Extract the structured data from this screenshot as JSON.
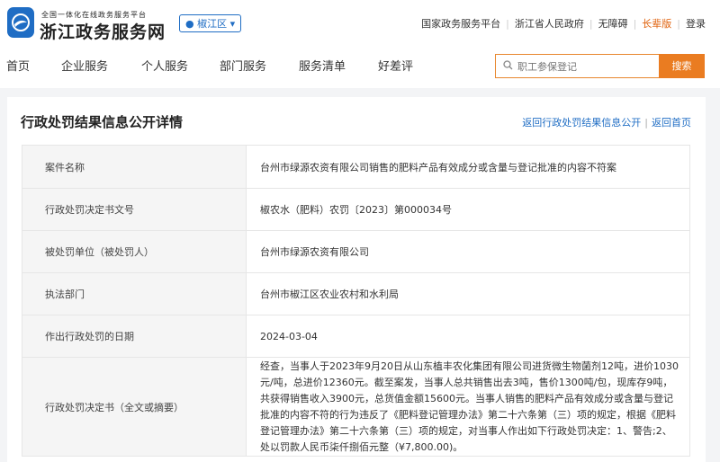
{
  "brand": {
    "subtitle": "全国一体化在线政务服务平台",
    "title": "浙江政务服务网"
  },
  "region": {
    "label": "椒江区"
  },
  "top_links": [
    "国家政务服务平台",
    "浙江省人民政府",
    "无障碍",
    "长辈版",
    "登录"
  ],
  "nav": [
    "首页",
    "企业服务",
    "个人服务",
    "部门服务",
    "服务清单",
    "好差评"
  ],
  "search": {
    "placeholder": "职工参保登记",
    "button": "搜索"
  },
  "card": {
    "title": "行政处罚结果信息公开详情",
    "links": [
      "返回行政处罚结果信息公开",
      "返回首页"
    ]
  },
  "details": [
    {
      "label": "案件名称",
      "value": "台州市绿源农资有限公司销售的肥料产品有效成分或含量与登记批准的内容不符案"
    },
    {
      "label": "行政处罚决定书文号",
      "value": "椒农水（肥料）农罚〔2023〕第000034号"
    },
    {
      "label": "被处罚单位（被处罚人）",
      "value": "台州市绿源农资有限公司"
    },
    {
      "label": "执法部门",
      "value": "台州市椒江区农业农村和水利局"
    },
    {
      "label": "作出行政处罚的日期",
      "value": "2024-03-04"
    },
    {
      "label": "行政处罚决定书（全文或摘要）",
      "value": "经查，当事人于2023年9月20日从山东植丰农化集团有限公司进货微生物菌剂12吨，进价1030元/吨，总进价12360元。截至案发，当事人总共销售出去3吨，售价1300吨/包，现库存9吨，共获得销售收入3900元，总货值金额15600元。当事人销售的肥料产品有效成分或含量与登记批准的内容不符的行为违反了《肥料登记管理办法》第二十六条第（三）项的规定，根据《肥料登记管理办法》第二十六条第（三）项的规定，对当事人作出如下行政处罚决定：1、警告;2、处以罚款人民币柒仟捌佰元整（¥7,800.00)。"
    }
  ],
  "colors": {
    "brand_blue": "#1f6dc4",
    "search_orange": "#ea7c21",
    "elder_orange": "#e0620d"
  }
}
